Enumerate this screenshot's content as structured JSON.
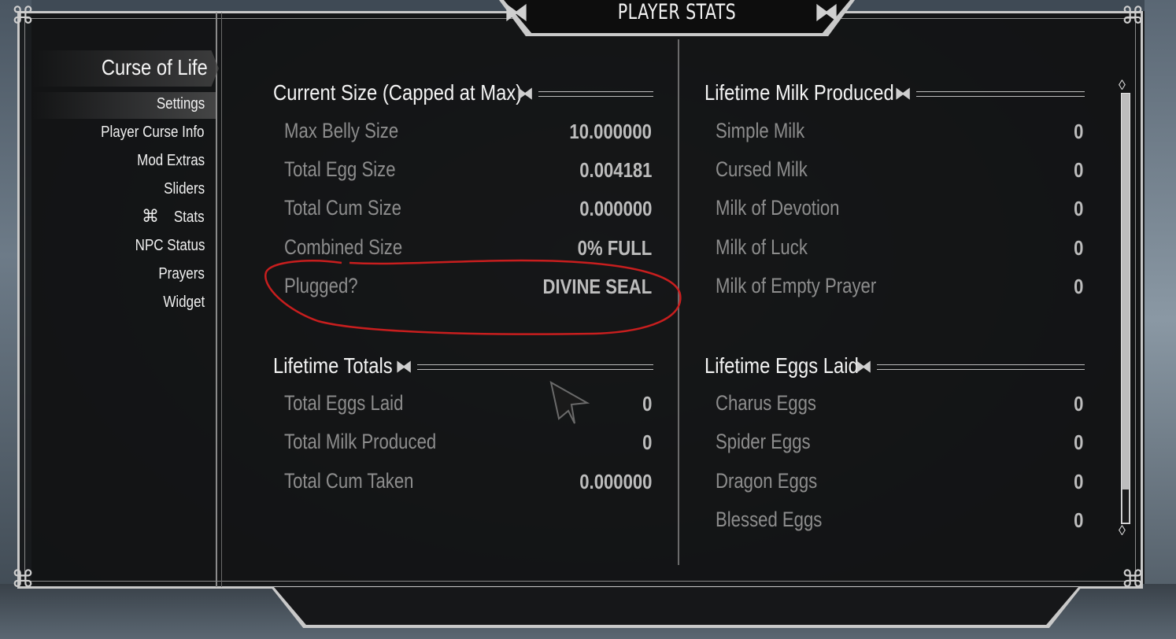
{
  "title": "PLAYER STATS",
  "sidebar": {
    "mod_title": "Curse of Life",
    "items": [
      {
        "label": "Settings",
        "selected": true
      },
      {
        "label": "Player Curse Info"
      },
      {
        "label": "Mod Extras"
      },
      {
        "label": "Sliders"
      },
      {
        "label": "Stats",
        "active_icon": "knot-icon"
      },
      {
        "label": "NPC Status"
      },
      {
        "label": "Prayers"
      },
      {
        "label": "Widget"
      }
    ]
  },
  "sections": {
    "current_size": {
      "header": "Current Size (Capped at Max)",
      "rows": [
        {
          "label": "Max Belly Size",
          "value": "10.000000"
        },
        {
          "label": "Total Egg Size",
          "value": "0.004181"
        },
        {
          "label": "Total Cum Size",
          "value": "0.000000"
        },
        {
          "label": "Combined Size",
          "value": "0% FULL"
        },
        {
          "label": "Plugged?",
          "value": "DIVINE SEAL"
        }
      ]
    },
    "lifetime_totals": {
      "header": "Lifetime Totals",
      "rows": [
        {
          "label": "Total Eggs Laid",
          "value": "0"
        },
        {
          "label": "Total Milk Produced",
          "value": "0"
        },
        {
          "label": "Total Cum Taken",
          "value": "0.000000"
        }
      ]
    },
    "lifetime_milk": {
      "header": "Lifetime Milk Produced",
      "rows": [
        {
          "label": "Simple Milk",
          "value": "0"
        },
        {
          "label": "Cursed Milk",
          "value": "0"
        },
        {
          "label": "Milk of Devotion",
          "value": "0"
        },
        {
          "label": "Milk of Luck",
          "value": "0"
        },
        {
          "label": "Milk of Empty Prayer",
          "value": "0"
        }
      ]
    },
    "lifetime_eggs": {
      "header": "Lifetime Eggs Laid",
      "rows": [
        {
          "label": "Charus  Eggs",
          "value": "0"
        },
        {
          "label": "Spider  Eggs",
          "value": "0"
        },
        {
          "label": "Dragon  Eggs",
          "value": "0"
        },
        {
          "label": "Blessed Eggs",
          "value": "0"
        }
      ]
    }
  },
  "colors": {
    "frame": "#c9c9c9",
    "label": "#8d8d8d",
    "value": "#bdbdbd",
    "annotation": "#c81e1e"
  }
}
